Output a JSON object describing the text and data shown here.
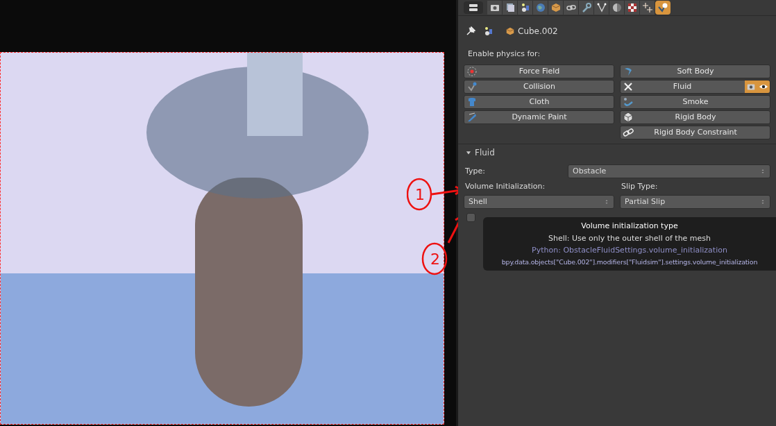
{
  "annotations": [
    {
      "label": "1"
    },
    {
      "label": "2"
    }
  ],
  "properties": {
    "tabs": [
      {
        "kind": "render",
        "selected": false
      },
      {
        "kind": "layers",
        "selected": false
      },
      {
        "kind": "scene",
        "selected": false
      },
      {
        "kind": "world",
        "selected": false
      },
      {
        "kind": "object",
        "selected": false
      },
      {
        "kind": "constraints",
        "selected": false
      },
      {
        "kind": "modifiers",
        "selected": false
      },
      {
        "kind": "data",
        "selected": false
      },
      {
        "kind": "material",
        "selected": false
      },
      {
        "kind": "texture",
        "selected": false
      },
      {
        "kind": "particles",
        "selected": false
      },
      {
        "kind": "physics",
        "selected": true
      }
    ],
    "breadcrumb": {
      "object": "Cube.002"
    },
    "physics_heading": "Enable physics for:",
    "left_buttons": [
      {
        "label": "Force Field",
        "kind": "field"
      },
      {
        "label": "Collision",
        "kind": "collision"
      },
      {
        "label": "Cloth",
        "kind": "cloth"
      },
      {
        "label": "Dynamic Paint",
        "kind": "paint"
      }
    ],
    "right_buttons": [
      {
        "label": "Soft Body",
        "kind": "softbody",
        "enabled": false
      },
      {
        "label": "Fluid",
        "kind": "remove",
        "enabled": true,
        "render_on": true,
        "view_on": true
      },
      {
        "label": "Smoke",
        "kind": "smoke",
        "enabled": false
      },
      {
        "label": "Rigid Body",
        "kind": "rigid",
        "enabled": false
      },
      {
        "label": "Rigid Body Constraint",
        "kind": "link",
        "enabled": false
      }
    ],
    "fluid_panel": {
      "title": "Fluid",
      "expanded": true,
      "type_label": "Type:",
      "type_value": "Obstacle",
      "volume_label": "Volume Initialization:",
      "volume_value": "Shell",
      "slip_label": "Slip Type:",
      "slip_value": "Partial Slip",
      "export_checked": false
    }
  },
  "tooltip": {
    "title": "Volume initialization type",
    "description": "Shell: Use only the outer shell of the mesh",
    "python": "Python: ObstacleFluidSettings.volume_initialization",
    "path": "bpy.data.objects[\"Cube.002\"].modifiers[\"Fluidsim\"].settings.volume_initialization"
  }
}
